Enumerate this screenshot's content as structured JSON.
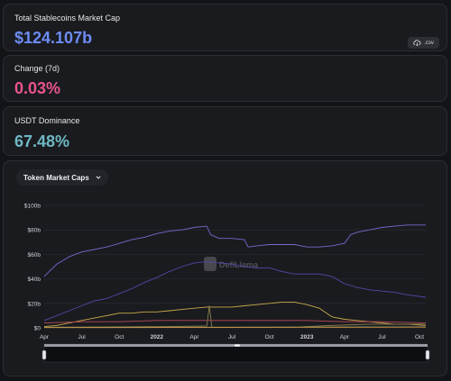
{
  "cards": {
    "market_cap": {
      "label": "Total Stablecoins Market Cap",
      "value": "$124.107b",
      "value_color": "#6d8cf4"
    },
    "change": {
      "label": "Change (7d)",
      "value": "0.03%",
      "value_color": "#e8548f"
    },
    "dominance": {
      "label": "USDT Dominance",
      "value": "67.48%",
      "value_color": "#6fb8c4"
    }
  },
  "csv_button": {
    "label": ".csv",
    "icon": "cloud-download-icon"
  },
  "token_dropdown": {
    "label": "Token Market Caps",
    "icon": "chevron-down-icon"
  },
  "watermark": "DefiLlama",
  "chart_data": {
    "type": "line",
    "yticks": [
      "$0",
      "$20b",
      "$40b",
      "$60b",
      "$80b",
      "$100b"
    ],
    "ylim": [
      0,
      100
    ],
    "x_ticks": [
      "Apr",
      "Jul",
      "Oct",
      "2022",
      "Apr",
      "Jul",
      "Oct",
      "2023",
      "Apr",
      "Jul",
      "Oct"
    ],
    "x_tick_bold": [
      false,
      false,
      false,
      true,
      false,
      false,
      false,
      true,
      false,
      false,
      false
    ],
    "x_tick_months": [
      0,
      3,
      6,
      9,
      12,
      15,
      18,
      21,
      24,
      27,
      30
    ],
    "x_months_span": 30.5,
    "series": [
      {
        "color": "#7469cc",
        "points": [
          [
            0,
            42
          ],
          [
            1,
            52
          ],
          [
            2,
            58
          ],
          [
            3,
            62
          ],
          [
            4,
            64
          ],
          [
            5,
            66
          ],
          [
            6,
            69
          ],
          [
            7,
            72
          ],
          [
            8,
            74
          ],
          [
            9,
            77
          ],
          [
            10,
            79
          ],
          [
            11,
            80
          ],
          [
            12,
            82
          ],
          [
            13,
            83
          ],
          [
            13.3,
            76
          ],
          [
            14,
            73
          ],
          [
            15,
            73
          ],
          [
            16,
            72
          ],
          [
            16.3,
            66
          ],
          [
            17,
            67
          ],
          [
            18,
            68
          ],
          [
            19,
            68
          ],
          [
            20,
            68
          ],
          [
            21,
            66
          ],
          [
            22,
            66
          ],
          [
            23,
            67
          ],
          [
            24,
            69
          ],
          [
            24.5,
            76
          ],
          [
            25,
            78
          ],
          [
            26,
            80
          ],
          [
            27,
            82
          ],
          [
            28,
            83
          ],
          [
            29,
            84
          ],
          [
            30.5,
            84
          ]
        ]
      },
      {
        "color": "#4c4aa6",
        "points": [
          [
            0,
            6
          ],
          [
            1,
            10
          ],
          [
            2,
            14
          ],
          [
            3,
            18
          ],
          [
            4,
            22
          ],
          [
            5,
            24
          ],
          [
            6,
            28
          ],
          [
            7,
            32
          ],
          [
            8,
            37
          ],
          [
            9,
            41
          ],
          [
            10,
            46
          ],
          [
            11,
            50
          ],
          [
            12,
            53
          ],
          [
            13,
            54
          ],
          [
            14,
            53
          ],
          [
            15,
            52
          ],
          [
            16,
            50
          ],
          [
            17,
            49
          ],
          [
            18,
            49
          ],
          [
            19,
            46
          ],
          [
            20,
            44
          ],
          [
            21,
            44
          ],
          [
            22,
            44
          ],
          [
            23,
            42
          ],
          [
            24,
            36
          ],
          [
            25,
            33
          ],
          [
            26,
            31
          ],
          [
            27,
            30
          ],
          [
            28,
            29
          ],
          [
            29,
            27
          ],
          [
            30.5,
            25
          ]
        ]
      },
      {
        "color": "#c9a84a",
        "points": [
          [
            0,
            1
          ],
          [
            1,
            2
          ],
          [
            2,
            4
          ],
          [
            3,
            6
          ],
          [
            4,
            8
          ],
          [
            5,
            10
          ],
          [
            6,
            12
          ],
          [
            7,
            12
          ],
          [
            8,
            13
          ],
          [
            9,
            13
          ],
          [
            10,
            14
          ],
          [
            11,
            15
          ],
          [
            12,
            16
          ],
          [
            13,
            17
          ],
          [
            14,
            17
          ],
          [
            15,
            17
          ],
          [
            16,
            18
          ],
          [
            17,
            19
          ],
          [
            18,
            20
          ],
          [
            19,
            21
          ],
          [
            20,
            21
          ],
          [
            21,
            19
          ],
          [
            22,
            16
          ],
          [
            23,
            9
          ],
          [
            24,
            7
          ],
          [
            25,
            6
          ],
          [
            26,
            5
          ],
          [
            27,
            4
          ],
          [
            28,
            3
          ],
          [
            29,
            3
          ],
          [
            30.5,
            2
          ]
        ]
      },
      {
        "color": "#b84a5a",
        "points": [
          [
            0,
            4
          ],
          [
            3,
            5
          ],
          [
            6,
            5
          ],
          [
            9,
            6
          ],
          [
            12,
            6
          ],
          [
            15,
            6
          ],
          [
            18,
            6
          ],
          [
            21,
            6
          ],
          [
            24,
            5
          ],
          [
            27,
            5
          ],
          [
            30.5,
            4
          ]
        ]
      },
      {
        "color": "#8a7f4f",
        "points": [
          [
            0,
            0.5
          ],
          [
            10,
            1
          ],
          [
            13,
            1.5
          ],
          [
            13.2,
            18
          ],
          [
            13.4,
            0.5
          ],
          [
            20,
            0.5
          ],
          [
            23,
            2
          ],
          [
            26,
            3
          ],
          [
            30.5,
            3
          ]
        ]
      },
      {
        "color": "#52b09a",
        "points": [
          [
            0,
            0.3
          ],
          [
            15,
            0.5
          ],
          [
            22,
            0.6
          ],
          [
            30.5,
            0.8
          ]
        ]
      },
      {
        "color": "#d58e3c",
        "points": [
          [
            0,
            0.2
          ],
          [
            10,
            0.3
          ],
          [
            20,
            0.5
          ],
          [
            30.5,
            0.6
          ]
        ]
      }
    ]
  }
}
